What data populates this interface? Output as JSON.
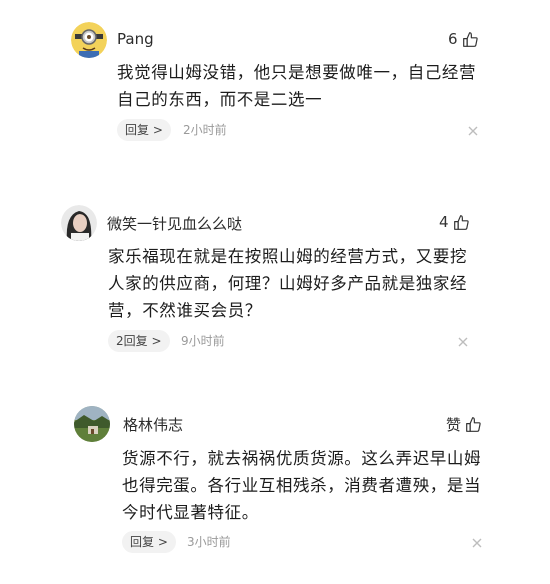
{
  "comments": [
    {
      "username": "Pang",
      "likes": "6",
      "text_lines": [
        "我觉得山姆没错，他只是想要做唯一，自己经营",
        "自己的东西，而不是二选一"
      ],
      "reply_label": "回复 >",
      "time": "2小时前",
      "avatar": "minion-avatar"
    },
    {
      "username": "微笑一针见血么么哒",
      "likes": "4",
      "text_lines": [
        "家乐福现在就是在按照山姆的经营方式，又要挖",
        "人家的供应商，何理？山姆好多产品就是独家经",
        "营，不然谁买会员？"
      ],
      "reply_label": "2回复 >",
      "time": "9小时前",
      "avatar": "portrait-avatar"
    },
    {
      "username": "格林伟志",
      "likes": "赞",
      "text_lines": [
        "货源不行，就去祸祸优质货源。这么弄迟早山姆",
        "也得完蛋。各行业互相残杀，消费者遭殃，是当",
        "今时代显著特征。"
      ],
      "reply_label": "回复 >",
      "time": "3小时前",
      "avatar": "landscape-avatar"
    }
  ],
  "colors": {
    "background": "#ffffff",
    "reply_bg": "#f2f2f2",
    "time_text": "#9a9a9a"
  }
}
